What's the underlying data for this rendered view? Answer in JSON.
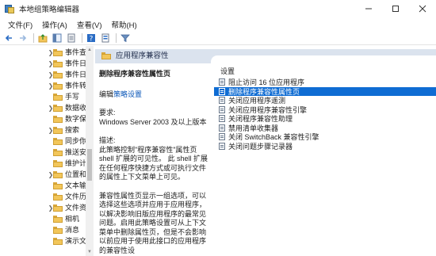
{
  "window": {
    "title": "本地组策略编辑器"
  },
  "menu": [
    {
      "label": "文件(F)"
    },
    {
      "label": "操作(A)"
    },
    {
      "label": "查看(V)"
    },
    {
      "label": "帮助(H)"
    }
  ],
  "toolbar": {
    "icons": [
      "back-arrow-icon",
      "forward-arrow-icon",
      "up-folder-icon",
      "show-hide-tree-icon",
      "export-list-icon",
      "help-icon",
      "properties-icon",
      "filter-icon"
    ]
  },
  "tree": {
    "items": [
      {
        "label": "事件查",
        "expandable": true
      },
      {
        "label": "事件日",
        "expandable": true
      },
      {
        "label": "事件日",
        "expandable": true
      },
      {
        "label": "事件转",
        "expandable": true
      },
      {
        "label": "手写",
        "expandable": false
      },
      {
        "label": "数据收",
        "expandable": true
      },
      {
        "label": "数字保",
        "expandable": false
      },
      {
        "label": "搜索",
        "expandable": true
      },
      {
        "label": "同步你",
        "expandable": false
      },
      {
        "label": "推送安",
        "expandable": false
      },
      {
        "label": "维护计",
        "expandable": false
      },
      {
        "label": "位置和",
        "expandable": true
      },
      {
        "label": "文本输",
        "expandable": false
      },
      {
        "label": "文件历",
        "expandable": false
      },
      {
        "label": "文件资",
        "expandable": true
      },
      {
        "label": "相机",
        "expandable": false
      },
      {
        "label": "消息",
        "expandable": false
      },
      {
        "label": "演示文",
        "expandable": false
      }
    ]
  },
  "right_pane": {
    "header_title": "应用程序兼容性",
    "description": {
      "title": "删除程序兼容性属性页",
      "edit_prefix": "编辑",
      "edit_link": "策略设置",
      "requirement_label": "要求:",
      "requirement_value": "Windows Server 2003 及以上版本",
      "desc_label": "描述:",
      "desc_text": "此策略控制\"程序兼容性\"属性页 shell 扩展的可见性。 此 shell 扩展在任何程序快捷方式或可执行文件的属性上下文菜单上可见。",
      "desc_text2": "兼容性属性页显示一组选项，可以选择这些选项并应用于应用程序，以解决影响旧版应用程序的最常见问题。启用此策略设置可从上下文菜单中删除属性页，但是不会影响以前应用于使用此接口的应用程序的兼容性设"
    },
    "list": {
      "header": "设置",
      "selected_index": 1,
      "items": [
        {
          "label": "阻止访问 16 位应用程序"
        },
        {
          "label": "删除程序兼容性属性页"
        },
        {
          "label": "关闭应用程序遥测"
        },
        {
          "label": "关闭应用程序兼容性引擎"
        },
        {
          "label": "关闭程序兼容性助理"
        },
        {
          "label": "禁用清单收集器"
        },
        {
          "label": "关闭 SwitchBack 兼容性引擎"
        },
        {
          "label": "关闭问题步骤记录器"
        }
      ]
    }
  },
  "colors": {
    "selection": "#0f6cd3",
    "header_band": "#dbe3ee",
    "folder": "#f2c65a",
    "link": "#0b57b8"
  }
}
